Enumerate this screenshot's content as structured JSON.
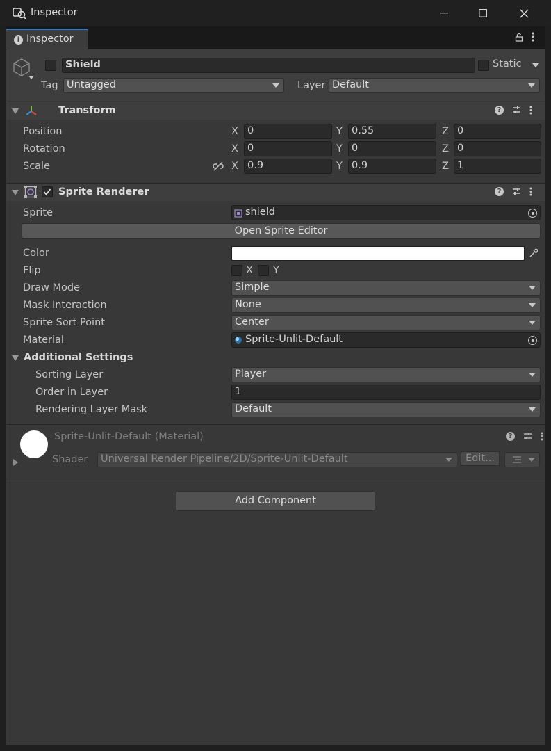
{
  "window": {
    "title": "Inspector",
    "minimize": "—",
    "maximize": "☐",
    "close": "✕"
  },
  "tab": {
    "label": "Inspector"
  },
  "gameobject": {
    "name": "Shield",
    "static_label": "Static",
    "tag_label": "Tag",
    "tag_value": "Untagged",
    "layer_label": "Layer",
    "layer_value": "Default"
  },
  "transform": {
    "title": "Transform",
    "rows": [
      {
        "label": "Position",
        "x": "0",
        "y": "0.55",
        "z": "0"
      },
      {
        "label": "Rotation",
        "x": "0",
        "y": "0",
        "z": "0"
      },
      {
        "label": "Scale",
        "x": "0.9",
        "y": "0.9",
        "z": "1"
      }
    ],
    "axis_x": "X",
    "axis_y": "Y",
    "axis_z": "Z"
  },
  "sprite_renderer": {
    "title": "Sprite Renderer",
    "sprite_label": "Sprite",
    "sprite_value": "shield",
    "open_editor": "Open Sprite Editor",
    "color_label": "Color",
    "color_value": "#ffffff",
    "flip_label": "Flip",
    "flip_x": "X",
    "flip_y": "Y",
    "draw_mode_label": "Draw Mode",
    "draw_mode_value": "Simple",
    "mask_label": "Mask Interaction",
    "mask_value": "None",
    "sort_point_label": "Sprite Sort Point",
    "sort_point_value": "Center",
    "material_label": "Material",
    "material_value": "Sprite-Unlit-Default",
    "additional_label": "Additional Settings",
    "sorting_layer_label": "Sorting Layer",
    "sorting_layer_value": "Player",
    "order_label": "Order in Layer",
    "order_value": "1",
    "render_mask_label": "Rendering Layer Mask",
    "render_mask_value": "Default"
  },
  "material": {
    "title": "Sprite-Unlit-Default (Material)",
    "shader_label": "Shader",
    "shader_value": "Universal Render Pipeline/2D/Sprite-Unlit-Default",
    "edit_label": "Edit..."
  },
  "add_component": "Add Component"
}
